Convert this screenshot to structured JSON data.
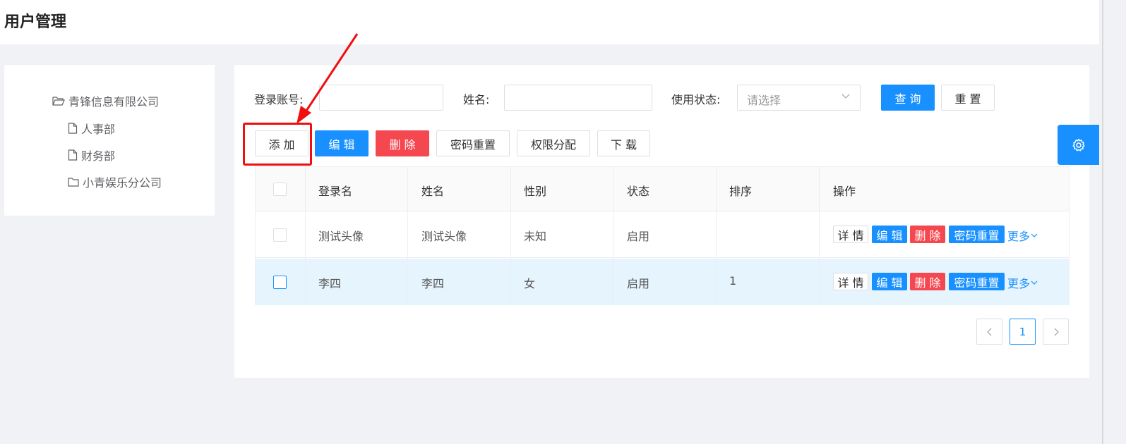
{
  "page": {
    "title": "用户管理"
  },
  "tree": {
    "root": "青锋信息有限公司",
    "children": [
      {
        "label": "人事部",
        "type": "file"
      },
      {
        "label": "财务部",
        "type": "file"
      },
      {
        "label": "小青娱乐分公司",
        "type": "folder"
      }
    ]
  },
  "search": {
    "account_label": "登录账号:",
    "account_value": "",
    "name_label": "姓名:",
    "name_value": "",
    "status_label": "使用状态:",
    "status_placeholder": "请选择",
    "query_label": "查 询",
    "reset_label": "重 置"
  },
  "toolbar": {
    "add": "添 加",
    "edit": "编 辑",
    "delete": "删 除",
    "password_reset": "密码重置",
    "permission": "权限分配",
    "download": "下 载"
  },
  "table": {
    "headers": [
      "登录名",
      "姓名",
      "性别",
      "状态",
      "排序",
      "操作"
    ],
    "rows": [
      {
        "login": "测试头像",
        "name": "测试头像",
        "gender": "未知",
        "status": "启用",
        "order": "",
        "selected": false
      },
      {
        "login": "李四",
        "name": "李四",
        "gender": "女",
        "status": "启用",
        "order": "1",
        "selected": true
      }
    ],
    "actions": {
      "detail": "详 情",
      "edit": "编 辑",
      "delete": "删 除",
      "reset": "密码重置",
      "more": "更多"
    }
  },
  "pagination": {
    "current": "1"
  },
  "colors": {
    "primary": "#1890ff",
    "danger": "#f5474f",
    "highlight": "#f10e0e",
    "selected_row": "#e6f4fd"
  },
  "icons": {
    "tree_root": "folder-open-icon",
    "tree_file": "file-icon",
    "tree_folder": "folder-icon",
    "settings": "gear-icon"
  }
}
